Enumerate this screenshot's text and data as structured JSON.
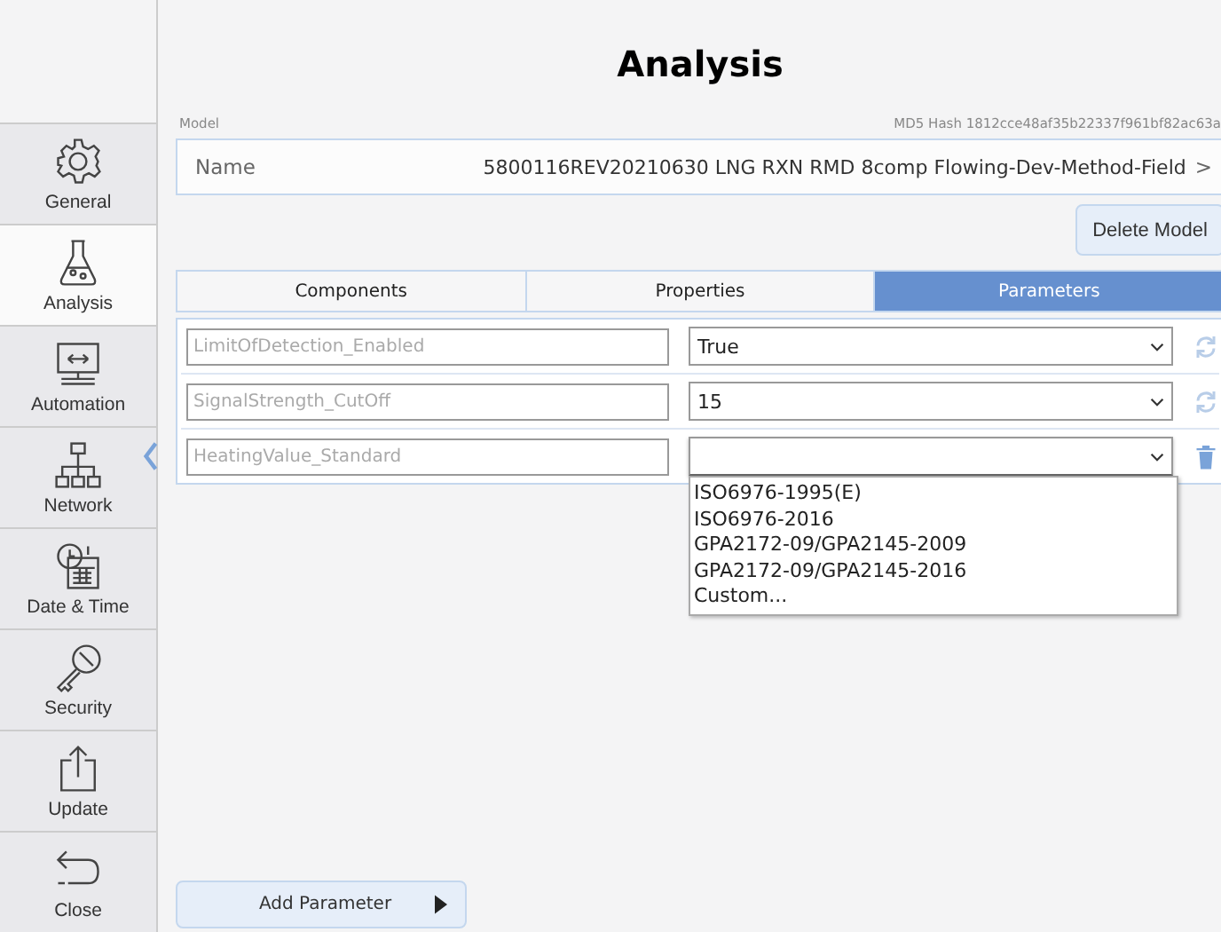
{
  "sidebar": {
    "items": [
      {
        "label": "General",
        "selected": false
      },
      {
        "label": "Analysis",
        "selected": true
      },
      {
        "label": "Automation",
        "selected": false
      },
      {
        "label": "Network",
        "selected": false
      },
      {
        "label": "Date & Time",
        "selected": false
      },
      {
        "label": "Security",
        "selected": false
      },
      {
        "label": "Update",
        "selected": false
      },
      {
        "label": "Close",
        "selected": false
      }
    ]
  },
  "title": "Analysis",
  "model": {
    "label": "Model",
    "hash": "MD5 Hash 1812cce48af35b22337f961bf82ac63a",
    "name_label": "Name",
    "name_value": "5800116REV20210630 LNG RXN RMD 8comp Flowing-Dev-Method-Field",
    "chevron": ">"
  },
  "delete_button": "Delete Model",
  "tabs": [
    {
      "label": "Components",
      "selected": false
    },
    {
      "label": "Properties",
      "selected": false
    },
    {
      "label": "Parameters",
      "selected": true
    }
  ],
  "parameters": [
    {
      "name": "LimitOfDetection_Enabled",
      "value": "True",
      "kind": "refresh",
      "expanded": false
    },
    {
      "name": "SignalStrength_CutOff",
      "value": "15",
      "kind": "refresh",
      "expanded": false
    },
    {
      "name": "HeatingValue_Standard",
      "kind": "delete",
      "expanded": true,
      "options": [
        "ISO6976-1995(E)",
        "ISO6976-2016",
        "GPA2172-09/GPA2145-2009",
        "GPA2172-09/GPA2145-2016",
        "Custom..."
      ]
    }
  ],
  "add_button": "Add Parameter"
}
